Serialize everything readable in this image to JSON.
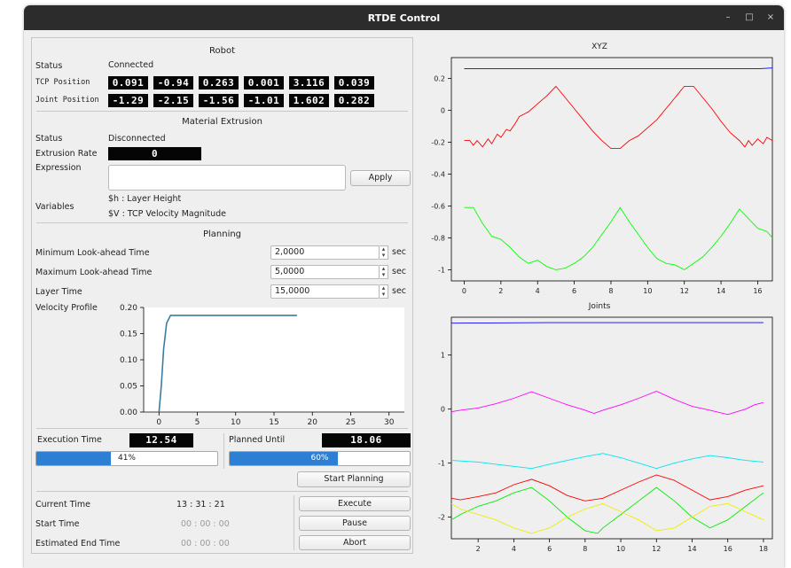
{
  "window": {
    "title": "RTDE Control",
    "controls": [
      "–",
      "□",
      "×"
    ]
  },
  "robot": {
    "section_title": "Robot",
    "status_label": "Status",
    "status_value": "Connected",
    "tcp_label": "TCP Position",
    "tcp_values": [
      "0.091",
      "-0.94",
      "0.263",
      "0.001",
      "3.116",
      "0.039"
    ],
    "joint_label": "Joint Position",
    "joint_values": [
      "-1.29",
      "-2.15",
      "-1.56",
      "-1.01",
      "1.602",
      "0.282"
    ]
  },
  "extrusion": {
    "section_title": "Material Extrusion",
    "status_label": "Status",
    "status_value": "Disconnected",
    "rate_label": "Extrusion Rate",
    "rate_value": "0",
    "expression_label": "Expression",
    "expression_value": "",
    "apply_label": "Apply",
    "variables_label": "Variables",
    "variables": [
      "$h : Layer Height",
      "$V : TCP Velocity Magnitude"
    ]
  },
  "planning": {
    "section_title": "Planning",
    "fields": [
      {
        "label": "Minimum  Look-ahead Time",
        "value": "2,0000",
        "unit": "sec"
      },
      {
        "label": "Maximum Look-ahead Time",
        "value": "5,0000",
        "unit": "sec"
      },
      {
        "label": "Layer Time",
        "value": "15,0000",
        "unit": "sec"
      }
    ],
    "velocity_label": "Velocity Profile"
  },
  "execution": {
    "execution_time_label": "Execution Time",
    "execution_time_value": "12.54",
    "execution_progress": 41,
    "execution_progress_text": "41%",
    "planned_until_label": "Planned Until",
    "planned_until_value": "18.06",
    "planned_progress": 60,
    "planned_progress_text": "60%",
    "start_planning_label": "Start Planning",
    "current_time_label": "Current Time",
    "current_time_value": "13 : 31 : 21",
    "start_time_label": "Start Time",
    "start_time_value": "00 : 00 : 00",
    "end_time_label": "Estimated End Time",
    "end_time_value": "00 : 00 : 00",
    "execute_label": "Execute",
    "pause_label": "Pause",
    "abort_label": "Abort"
  },
  "colors": {
    "titlebar": "#2c2c2c",
    "progress": "#2d7fd3",
    "velocity_line": "#3a7ca0"
  },
  "chart_data": [
    {
      "name": "velocity_profile",
      "type": "line",
      "title": "",
      "xlim": [
        -2,
        32
      ],
      "ylim": [
        0,
        0.2
      ],
      "xticks": [
        0,
        5,
        10,
        15,
        20,
        25,
        30
      ],
      "yticks": [
        0.0,
        0.05,
        0.1,
        0.15,
        0.2
      ],
      "ytick_labels": [
        "0.00",
        "0.05",
        "0.10",
        "0.15",
        "0.20"
      ],
      "x": [
        0,
        0.3,
        0.6,
        1.0,
        1.5,
        18
      ],
      "y": [
        0,
        0.05,
        0.12,
        0.17,
        0.185,
        0.185
      ],
      "color": "#3a7ca0"
    },
    {
      "name": "xyz",
      "type": "line",
      "title": "XYZ",
      "xlim": [
        -0.7,
        16.8
      ],
      "ylim": [
        -1.07,
        0.33
      ],
      "xticks": [
        0,
        2,
        4,
        6,
        8,
        10,
        12,
        14,
        16
      ],
      "yticks": [
        0.2,
        0,
        -0.2,
        -0.4,
        -0.6,
        -0.8,
        -1
      ],
      "series": [
        {
          "color": "#0000ff",
          "x": [
            0,
            4,
            8,
            12,
            16,
            16.8
          ],
          "y": [
            0.26,
            0.26,
            0.26,
            0.26,
            0.26,
            0.265
          ]
        },
        {
          "color": "#ff0000",
          "x": [
            0,
            0.3,
            0.5,
            0.7,
            1,
            1.3,
            1.5,
            1.8,
            2,
            2.3,
            2.5,
            2.8,
            3,
            3.5,
            4,
            4.5,
            5,
            5.5,
            6,
            6.5,
            7,
            7.5,
            8,
            8.5,
            9,
            9.5,
            10,
            10.5,
            11,
            11.5,
            12,
            12.5,
            13,
            13.5,
            14,
            14.5,
            15,
            15.3,
            15.5,
            15.7,
            16,
            16.3,
            16.5,
            16.8
          ],
          "y": [
            -0.19,
            -0.19,
            -0.22,
            -0.19,
            -0.23,
            -0.18,
            -0.21,
            -0.15,
            -0.17,
            -0.12,
            -0.13,
            -0.08,
            -0.04,
            -0.01,
            0.04,
            0.09,
            0.15,
            0.08,
            0.01,
            -0.06,
            -0.13,
            -0.19,
            -0.24,
            -0.24,
            -0.19,
            -0.16,
            -0.11,
            -0.06,
            0.01,
            0.08,
            0.15,
            0.15,
            0.08,
            0.01,
            -0.07,
            -0.14,
            -0.19,
            -0.23,
            -0.19,
            -0.22,
            -0.18,
            -0.21,
            -0.17,
            -0.19
          ]
        },
        {
          "color": "#00ff00",
          "x": [
            0,
            0.5,
            1,
            1.5,
            2,
            2.5,
            3,
            3.5,
            4,
            4.5,
            5,
            5.5,
            6,
            6.5,
            7,
            7.5,
            8,
            8.5,
            9,
            9.5,
            10,
            10.5,
            11,
            11.5,
            12,
            12.5,
            13,
            13.5,
            14,
            14.5,
            15,
            15.5,
            16,
            16.5,
            16.8
          ],
          "y": [
            -0.61,
            -0.61,
            -0.71,
            -0.79,
            -0.81,
            -0.86,
            -0.92,
            -0.96,
            -0.94,
            -0.98,
            -1.0,
            -0.99,
            -0.96,
            -0.92,
            -0.86,
            -0.78,
            -0.7,
            -0.61,
            -0.7,
            -0.78,
            -0.86,
            -0.93,
            -0.96,
            -0.97,
            -1.0,
            -0.96,
            -0.92,
            -0.86,
            -0.79,
            -0.71,
            -0.62,
            -0.68,
            -0.74,
            -0.76,
            -0.8
          ]
        }
      ]
    },
    {
      "name": "joints",
      "type": "line",
      "title": "Joints",
      "xlim": [
        0.5,
        18.5
      ],
      "ylim": [
        -2.4,
        1.7
      ],
      "xticks": [
        2,
        4,
        6,
        8,
        10,
        12,
        14,
        16,
        18
      ],
      "yticks": [
        1,
        0,
        -1,
        -2
      ],
      "series": [
        {
          "color": "#0000ff",
          "x": [
            0.5,
            6,
            12,
            18
          ],
          "y": [
            1.59,
            1.6,
            1.6,
            1.6
          ]
        },
        {
          "color": "#ff00ff",
          "x": [
            0.5,
            1,
            2,
            3,
            4,
            5,
            6,
            7,
            8,
            8.5,
            9,
            10,
            11,
            12,
            13,
            14,
            15,
            16,
            16.5,
            17,
            17.5,
            18
          ],
          "y": [
            -0.05,
            -0.02,
            0.02,
            0.1,
            0.2,
            0.32,
            0.2,
            0.08,
            -0.02,
            -0.08,
            -0.02,
            0.08,
            0.2,
            0.33,
            0.18,
            0.05,
            -0.02,
            -0.1,
            -0.05,
            0.0,
            0.08,
            0.12
          ]
        },
        {
          "color": "#00e5ee",
          "x": [
            0.5,
            2,
            3,
            4,
            5,
            6,
            7,
            8,
            9,
            10,
            11,
            12,
            13,
            14,
            15,
            16,
            17,
            18
          ],
          "y": [
            -0.95,
            -0.98,
            -1.02,
            -1.06,
            -1.1,
            -1.02,
            -0.95,
            -0.88,
            -0.82,
            -0.9,
            -1.0,
            -1.1,
            -1.0,
            -0.92,
            -0.86,
            -0.9,
            -0.95,
            -0.98
          ]
        },
        {
          "color": "#ff0000",
          "x": [
            0.5,
            1,
            2,
            3,
            4,
            5,
            6,
            7,
            8,
            9,
            10,
            11,
            12,
            13,
            14,
            15,
            16,
            17,
            18
          ],
          "y": [
            -1.65,
            -1.68,
            -1.62,
            -1.55,
            -1.4,
            -1.3,
            -1.42,
            -1.6,
            -1.7,
            -1.65,
            -1.5,
            -1.35,
            -1.22,
            -1.32,
            -1.5,
            -1.68,
            -1.62,
            -1.5,
            -1.42
          ]
        },
        {
          "color": "#00ee00",
          "x": [
            0.5,
            1,
            2,
            3,
            4,
            5,
            6,
            7,
            8,
            8.7,
            9,
            10,
            11,
            12,
            13,
            14,
            15,
            16,
            17,
            18
          ],
          "y": [
            -2.05,
            -1.95,
            -1.8,
            -1.7,
            -1.55,
            -1.45,
            -1.7,
            -2.0,
            -2.25,
            -2.3,
            -2.2,
            -1.95,
            -1.7,
            -1.45,
            -1.7,
            -2.0,
            -2.2,
            -2.05,
            -1.8,
            -1.55
          ]
        },
        {
          "color": "#eeee00",
          "x": [
            0.5,
            1,
            2,
            3,
            4,
            5,
            6,
            7,
            8,
            9,
            10,
            11,
            12,
            13,
            14,
            15,
            16,
            17,
            18
          ],
          "y": [
            -1.75,
            -1.85,
            -1.95,
            -2.05,
            -2.2,
            -2.3,
            -2.2,
            -2.0,
            -1.85,
            -1.75,
            -1.9,
            -2.05,
            -2.25,
            -2.2,
            -2.0,
            -1.8,
            -1.75,
            -1.9,
            -2.05
          ]
        }
      ]
    }
  ]
}
